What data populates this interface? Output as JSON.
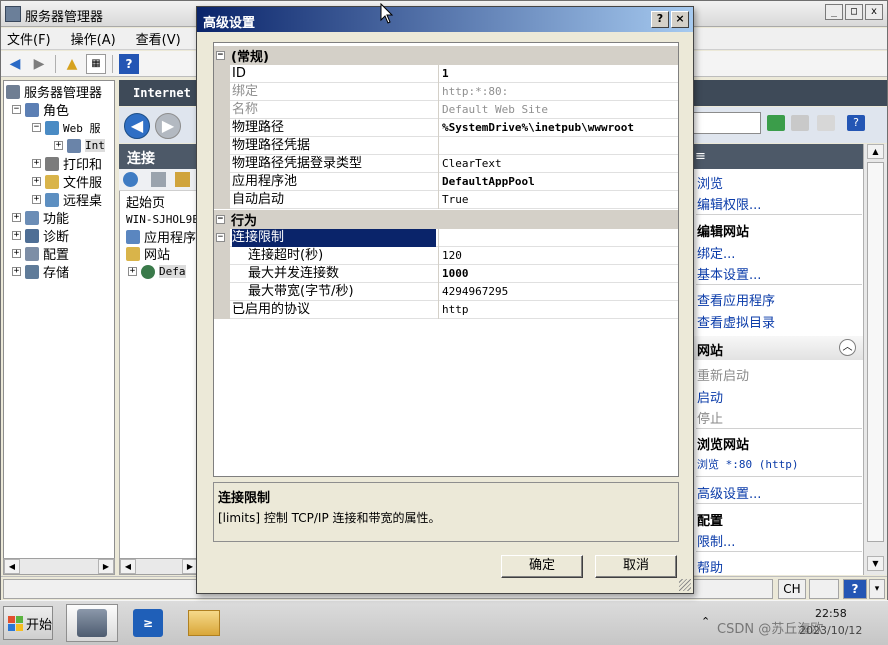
{
  "server_manager": {
    "title": "服务器管理器",
    "menu": [
      "文件(F)",
      "操作(A)",
      "查看(V)"
    ],
    "tree": {
      "root": "服务器管理器",
      "roles": "角色",
      "web": "Web 服",
      "iis": "Int",
      "print": "打印和",
      "file": "文件服",
      "remote": "远程桌",
      "features": "功能",
      "diagnostics": "诊断",
      "config": "配置",
      "storage": "存储"
    }
  },
  "iis": {
    "header": "Internet",
    "connections_title": "连接",
    "start_page": "起始页",
    "server": "WIN-SJHOL9E",
    "app_pools": "应用程序",
    "sites": "网站",
    "default_site": "Defa"
  },
  "actions": {
    "browse": "浏览",
    "edit_permissions": "编辑权限...",
    "edit_site_header": "编辑网站",
    "bindings": "绑定...",
    "basic_settings": "基本设置...",
    "view_apps": "查看应用程序",
    "view_vdirs": "查看虚拟目录",
    "manage_site_header": "网站",
    "restart": "重新启动",
    "start": "启动",
    "stop": "停止",
    "browse_site_header": "浏览网站",
    "browse_port": "浏览 *:80 (http)",
    "advanced_settings": "高级设置...",
    "config_header": "配置",
    "limits": "限制...",
    "help": "帮助"
  },
  "status_bar": {
    "ime": "CH"
  },
  "dialog": {
    "title": "高级设置",
    "help_btn": "?",
    "close_btn": "×",
    "categories": {
      "general": "(常规)",
      "behavior": "行为"
    },
    "properties": [
      {
        "name": "ID",
        "value": "1"
      },
      {
        "name": "绑定",
        "value": "http:*:80:"
      },
      {
        "name": "名称",
        "value": "Default Web Site"
      },
      {
        "name": "物理路径",
        "value": "%SystemDrive%\\inetpub\\wwwroot"
      },
      {
        "name": "物理路径凭据",
        "value": ""
      },
      {
        "name": "物理路径凭据登录类型",
        "value": "ClearText"
      },
      {
        "name": "应用程序池",
        "value": "DefaultAppPool"
      },
      {
        "name": "自动启动",
        "value": "True"
      }
    ],
    "behavior_properties": [
      {
        "name": "连接限制",
        "value": ""
      },
      {
        "name": "连接超时(秒)",
        "value": "120"
      },
      {
        "name": "最大并发连接数",
        "value": "1000"
      },
      {
        "name": "最大带宽(字节/秒)",
        "value": "4294967295"
      },
      {
        "name": "已启用的协议",
        "value": "http"
      }
    ],
    "description": {
      "title": "连接限制",
      "text": "[limits] 控制 TCP/IP 连接和带宽的属性。"
    },
    "ok": "确定",
    "cancel": "取消"
  },
  "taskbar": {
    "start": "开始",
    "tray_chevron": "⌃",
    "watermark": "CSDN @苏丘海欧",
    "time": "22:58",
    "date": "2023/10/12"
  }
}
